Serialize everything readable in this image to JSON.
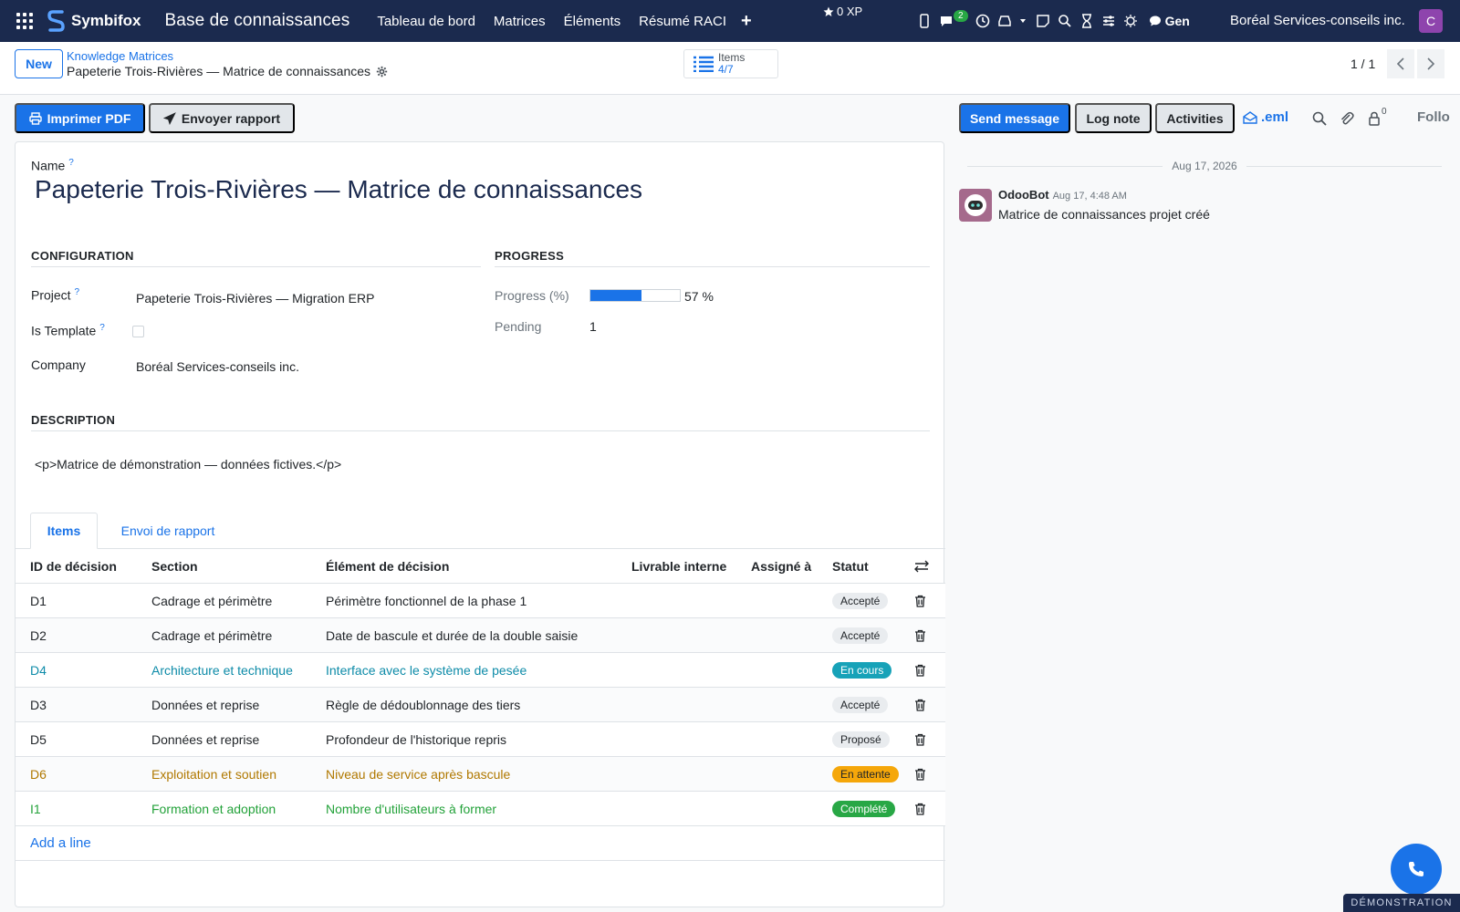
{
  "navbar": {
    "brand": "Symbifox",
    "app_title": "Base de connaissances",
    "menu": [
      "Tableau de bord",
      "Matrices",
      "Éléments",
      "Résumé RACI"
    ],
    "xp": "0 XP",
    "chat_badge": "2",
    "gen_label": "Gen",
    "company": "Boréal Services-conseils inc.",
    "avatar_letter": "C",
    "colors": {
      "bg": "#1b2a4e",
      "accent": "#1a73e8"
    }
  },
  "control": {
    "new_label": "New",
    "breadcrumb_parent": "Knowledge Matrices",
    "breadcrumb_current": "Papeterie Trois-Rivières — Matrice de connaissances",
    "items_stat_label": "Items",
    "items_stat_value": "4/7",
    "pager": "1 / 1"
  },
  "actions": {
    "print_pdf": "Imprimer PDF",
    "send_report": "Envoyer rapport",
    "send_message": "Send message",
    "log_note": "Log note",
    "activities": "Activities",
    "eml": ".eml",
    "followers_count": "0",
    "follow": "Follo"
  },
  "form": {
    "name_label": "Name",
    "name_value": "Papeterie Trois-Rivières — Matrice de connaissances",
    "config_title": "CONFIGURATION",
    "progress_title": "PROGRESS",
    "project_label": "Project",
    "project_value": "Papeterie Trois-Rivières — Migration ERP",
    "is_template_label": "Is Template",
    "is_template_value": false,
    "company_label": "Company",
    "company_value": "Boréal Services-conseils inc.",
    "progress_label": "Progress (%)",
    "progress_value": 57,
    "progress_text": "57 %",
    "pending_label": "Pending",
    "pending_value": "1",
    "description_title": "DESCRIPTION",
    "description_value": "<p>Matrice de démonstration — données fictives.</p>"
  },
  "tabs": {
    "items": "Items",
    "report": "Envoi de rapport"
  },
  "table": {
    "headers": {
      "id": "ID de décision",
      "section": "Section",
      "element": "Élément de décision",
      "deliverable": "Livrable interne",
      "assigned": "Assigné à",
      "status": "Statut"
    },
    "rows": [
      {
        "id": "D1",
        "section": "Cadrage et périmètre",
        "element": "Périmètre fonctionnel de la phase 1",
        "status": "Accepté",
        "tone": "default"
      },
      {
        "id": "D2",
        "section": "Cadrage et périmètre",
        "element": "Date de bascule et durée de la double saisie",
        "status": "Accepté",
        "tone": "default"
      },
      {
        "id": "D4",
        "section": "Architecture et technique",
        "element": "Interface avec le système de pesée",
        "status": "En cours",
        "tone": "info"
      },
      {
        "id": "D3",
        "section": "Données et reprise",
        "element": "Règle de dédoublonnage des tiers",
        "status": "Accepté",
        "tone": "default"
      },
      {
        "id": "D5",
        "section": "Données et reprise",
        "element": "Profondeur de l'historique repris",
        "status": "Proposé",
        "tone": "default"
      },
      {
        "id": "D6",
        "section": "Exploitation et soutien",
        "element": "Niveau de service après bascule",
        "status": "En attente",
        "tone": "warn"
      },
      {
        "id": "I1",
        "section": "Formation et adoption",
        "element": "Nombre d'utilisateurs à former",
        "status": "Complété",
        "tone": "done"
      }
    ],
    "add_line": "Add a line",
    "tone_colors": {
      "info": "#17a2b8",
      "warn": "#f5a70a",
      "done": "#28a745"
    }
  },
  "chatter": {
    "date": "Aug 17, 2026",
    "author": "OdooBot",
    "time": "Aug 17, 4:48 AM",
    "body": "Matrice de connaissances projet créé"
  },
  "ribbon": "DÉMONSTRATION"
}
